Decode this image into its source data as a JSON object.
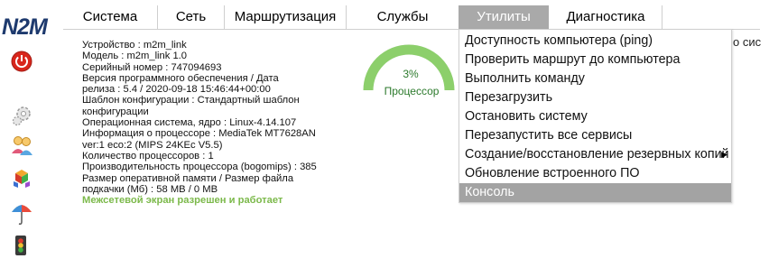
{
  "logo": "N2M",
  "menu": {
    "items": [
      {
        "label": "Система"
      },
      {
        "label": "Сеть"
      },
      {
        "label": "Маршрутизация"
      },
      {
        "label": "Службы"
      },
      {
        "label": "Утилиты"
      },
      {
        "label": "Диагностика"
      }
    ],
    "active": "Утилиты"
  },
  "info": {
    "lines": [
      "Устройство : m2m_link",
      "Модель : m2m_link 1.0",
      "Серийный номер : 747094693",
      "Версия программного обеспечения / Дата",
      "релиза : 5.4 / 2020-09-18 15:46:44+00:00",
      "Шаблон конфигурации : Стандартный шаблон",
      "конфигурации",
      "Операционная система, ядро : Linux-4.14.107",
      "Информация о процессоре : MediaTek MT7628AN",
      "ver:1 eco:2 (MIPS 24KEc V5.5)",
      "Количество процессоров : 1",
      "Производительность процессора (bogomips) : 385",
      "Размер оперативной памяти / Размер файла",
      "подкачки (Мб) : 58 MB / 0 MB"
    ],
    "firewall_status": "Межсетевой экран разрешен и работает"
  },
  "gauge": {
    "value_text": "3%",
    "value": 3,
    "label": "Процессор",
    "color": "#8ccf6b"
  },
  "partial_text": "о сис",
  "dropdown": {
    "items": [
      {
        "label": "Доступность компьютера (ping)"
      },
      {
        "label": "Проверить маршрут до компьютера"
      },
      {
        "label": "Выполнить команду"
      },
      {
        "label": "Перезагрузить"
      },
      {
        "label": "Остановить систему"
      },
      {
        "label": "Перезапустить все сервисы"
      },
      {
        "label": "Создание/восстановление резервных копий",
        "submenu": true
      },
      {
        "label": "Обновление встроенного ПО"
      },
      {
        "label": "Консоль"
      }
    ],
    "selected": "Консоль"
  },
  "colors": {
    "active_menu_bg": "#a9a9a9",
    "selected_item_bg": "#a3a3a3",
    "firewall_text": "#7cb94b",
    "logo": "#1e3a6e"
  }
}
